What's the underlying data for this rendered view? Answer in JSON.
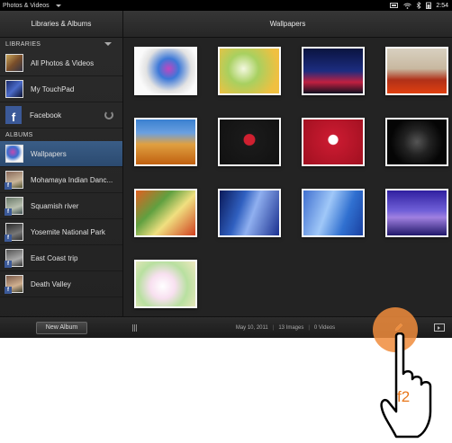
{
  "statusbar": {
    "app_name": "Photos & Videos",
    "time": "2:54"
  },
  "left_pane": {
    "title": "Libraries & Albums",
    "libraries_label": "LIBRARIES",
    "libraries": [
      {
        "label": "All Photos & Videos"
      },
      {
        "label": "My TouchPad"
      },
      {
        "label": "Facebook"
      }
    ],
    "albums_label": "ALBUMS",
    "albums": [
      {
        "label": "Wallpapers"
      },
      {
        "label": "Mohamaya Indian Danc..."
      },
      {
        "label": "Squamish river"
      },
      {
        "label": "Yosemite National Park"
      },
      {
        "label": "East Coast trip"
      },
      {
        "label": "Death Valley"
      }
    ],
    "new_album_label": "New Album"
  },
  "right_pane": {
    "title": "Wallpapers",
    "footer": {
      "date": "May 10, 2011",
      "images": "13 Images",
      "videos": "0 Videos"
    }
  },
  "overlay": {
    "key_label": "f2"
  },
  "colors": {
    "selected": "#2e5077",
    "tap": "#f08c3c",
    "key_label": "#e8771b",
    "facebook": "#3b5998"
  }
}
